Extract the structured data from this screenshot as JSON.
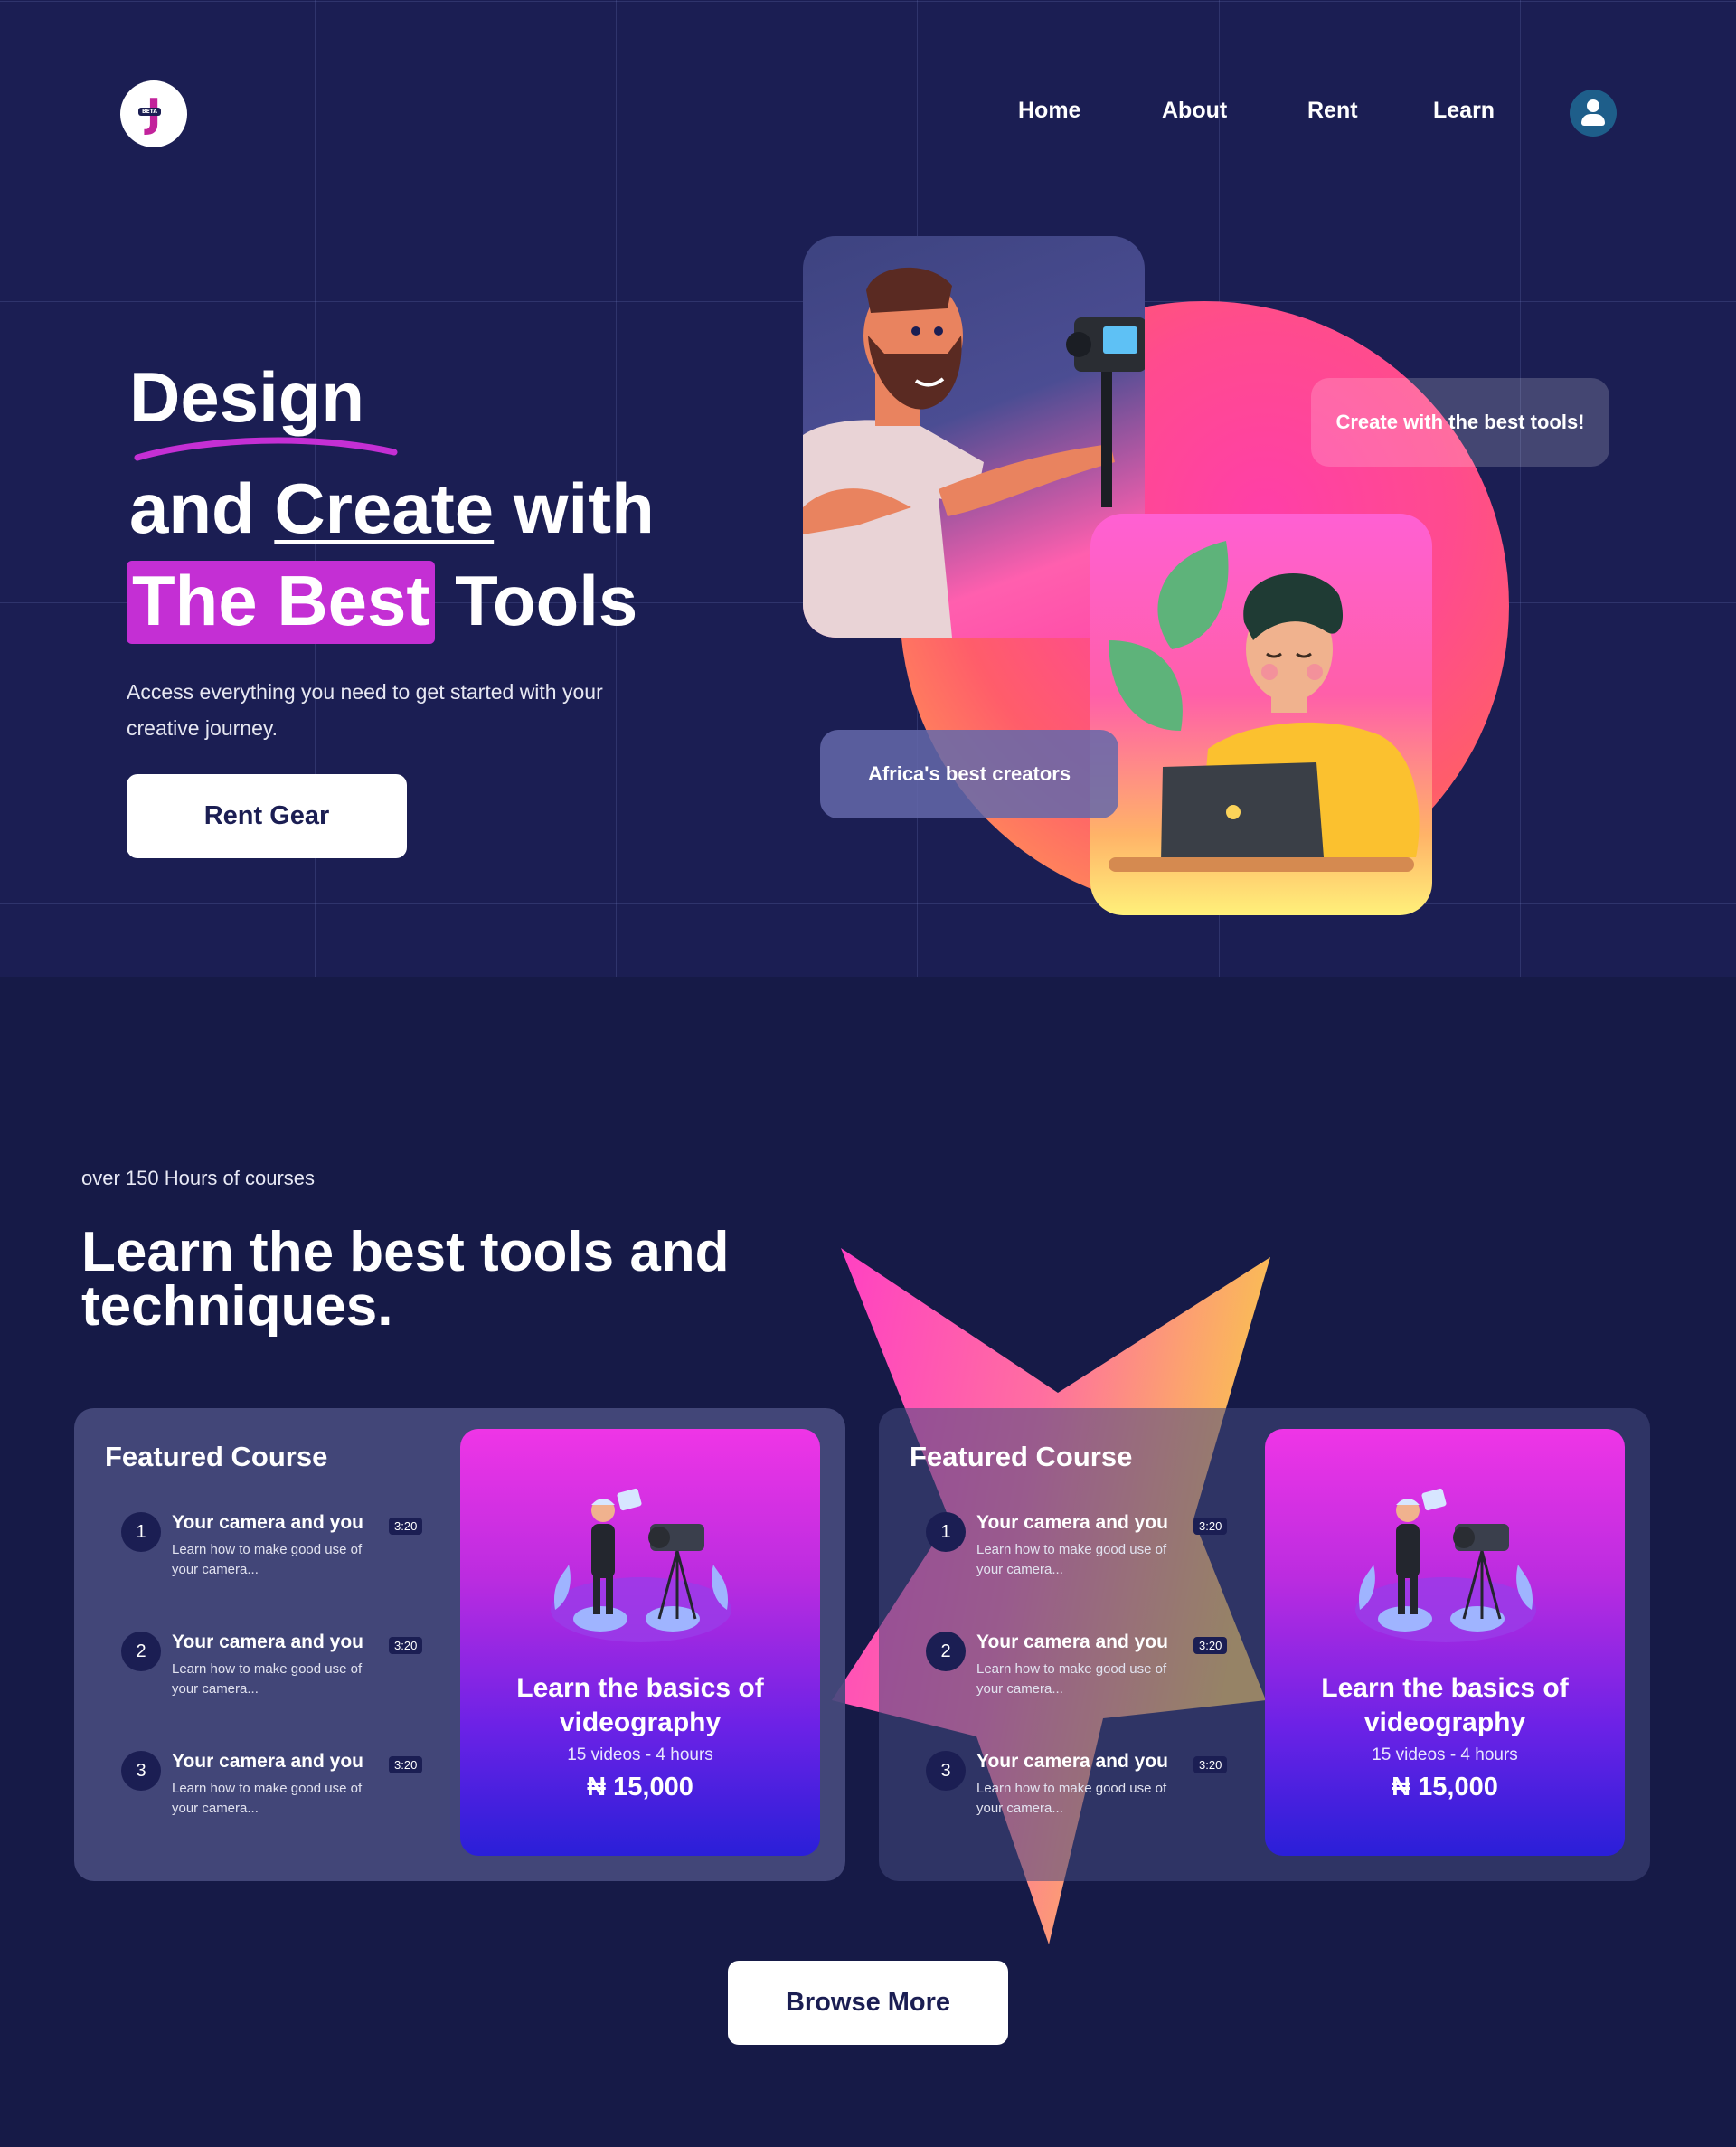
{
  "brand": {
    "logo_letter": "J",
    "badge": "BETA"
  },
  "nav": {
    "items": [
      {
        "label": "Home"
      },
      {
        "label": "About"
      },
      {
        "label": "Rent"
      },
      {
        "label": "Learn"
      }
    ]
  },
  "hero": {
    "line1": "Design",
    "line2_prefix": "and ",
    "line2_underlined": "Create",
    "line2_suffix": " with",
    "line3_highlight": "The Best",
    "line3_suffix": " Tools",
    "subtitle": "Access everything you need to get started with your creative journey.",
    "cta": "Rent Gear",
    "pill_tools": "Create with the best tools!",
    "pill_creators": "Africa's best creators"
  },
  "courses": {
    "kicker": "over 150 Hours of courses",
    "title": "Learn the best tools and techniques.",
    "browse": "Browse More",
    "panels": [
      {
        "heading": "Featured Course",
        "lessons": [
          {
            "num": "1",
            "title": "Your camera and you",
            "desc": "Learn how to make good use of your camera...",
            "time": "3:20"
          },
          {
            "num": "2",
            "title": "Your camera and you",
            "desc": "Learn how to make good use of your camera...",
            "time": "3:20"
          },
          {
            "num": "3",
            "title": "Your camera and you",
            "desc": "Learn how to make good use of your camera...",
            "time": "3:20"
          }
        ],
        "promo": {
          "title": "Learn the basics of videography",
          "meta": "15 videos - 4 hours",
          "price": "₦ 15,000"
        }
      },
      {
        "heading": "Featured Course",
        "lessons": [
          {
            "num": "1",
            "title": "Your camera and you",
            "desc": "Learn how to make good use of your camera...",
            "time": "3:20"
          },
          {
            "num": "2",
            "title": "Your camera and you",
            "desc": "Learn how to make good use of your camera...",
            "time": "3:20"
          },
          {
            "num": "3",
            "title": "Your camera and you",
            "desc": "Learn how to make good use of your camera...",
            "time": "3:20"
          }
        ],
        "promo": {
          "title": "Learn the basics of videography",
          "meta": "15 videos - 4 hours",
          "price": "₦ 15,000"
        }
      }
    ]
  },
  "colors": {
    "page_bg": "#161a47",
    "hero_bg": "#1b1e53",
    "accent_magenta": "#c42fd4",
    "promo_top": "#ef35e6",
    "promo_bottom": "#2a1fd8",
    "avatar": "#1e5e8a"
  }
}
